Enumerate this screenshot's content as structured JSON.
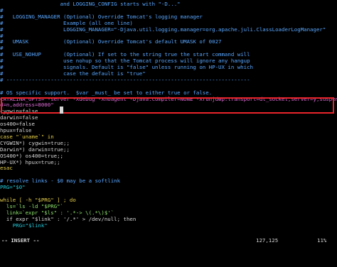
{
  "editor": {
    "lines": [
      {
        "text": "                   and LOGGING_CONFIG starts with \"-D...\"",
        "cls": "c-comment"
      },
      {
        "text": "#",
        "cls": "c-comment"
      },
      {
        "text": "#   LOGGING_MANAGER (Optional) Override Tomcat's logging manager",
        "cls": "c-comment"
      },
      {
        "text": "#                   Example (all one line)",
        "cls": "c-comment"
      },
      {
        "text": "#                   LOGGING_MANAGER=\"-Djava.util.logging.manager=org.apache.juli.ClassLoaderLogManager\"",
        "cls": "c-comment"
      },
      {
        "text": "#",
        "cls": "c-comment"
      },
      {
        "text": "#   UMASK           (Optional) Override Tomcat's default UMASK of 0027",
        "cls": "c-comment"
      },
      {
        "text": "#",
        "cls": "c-comment"
      },
      {
        "text": "#   USE_NOHUP       (Optional) If set to the string true the start command will",
        "cls": "c-comment"
      },
      {
        "text": "#                   use nohup so that the Tomcat process will ignore any hangup",
        "cls": "c-comment"
      },
      {
        "text": "#                   signals. Default is \"false\" unless running on HP-UX in which",
        "cls": "c-comment"
      },
      {
        "text": "#                   case the default is \"true\"",
        "cls": "c-comment"
      },
      {
        "text": "# -----------------------------------------------------------------------------",
        "cls": "c-comment"
      },
      {
        "text": "",
        "cls": "c-plain"
      },
      {
        "text": "# OS specific support.  $var _must_ be set to either true or false.",
        "cls": "c-comment"
      },
      {
        "text": "CATALINA_OPTS=\"-server -Xdebug -Xnoagent -Djava.compiler=NONE -Xrunjdwp:transport=dt_socket,server=y,suspen",
        "cls": "c-str"
      },
      {
        "text": "d=n,address=8000\"",
        "cls": "c-str"
      },
      {
        "text": "cygwin=false",
        "cls": "c-plain"
      },
      {
        "text": "darwin=false",
        "cls": "c-plain"
      },
      {
        "text": "os400=false",
        "cls": "c-plain"
      },
      {
        "text": "hpux=false",
        "cls": "c-plain"
      },
      {
        "text": "case \"`uname`\" in",
        "cls": "c-kw"
      },
      {
        "text": "CYGWIN*) cygwin=true;;",
        "cls": "c-plain"
      },
      {
        "text": "Darwin*) darwin=true;;",
        "cls": "c-plain"
      },
      {
        "text": "OS400*) os400=true;;",
        "cls": "c-plain"
      },
      {
        "text": "HP-UX*) hpux=true;;",
        "cls": "c-plain"
      },
      {
        "text": "esac",
        "cls": "c-kw"
      },
      {
        "text": "",
        "cls": "c-plain"
      },
      {
        "text": "# resolve links - $0 may be a softlink",
        "cls": "c-comment"
      },
      {
        "text": "PRG=\"$0\"",
        "cls": "c-var"
      },
      {
        "text": "",
        "cls": "c-plain"
      },
      {
        "text": "while [ -h \"$PRG\" ] ; do",
        "cls": "c-kw"
      },
      {
        "text": "  ls=`ls -ld \"$PRG\"`",
        "cls": "c-green"
      },
      {
        "text": "  link=`expr \"$ls\" : '.*-> \\(.*\\)$'`",
        "cls": "c-green"
      },
      {
        "text": "  if expr \"$link\" : '/.*' > /dev/null; then",
        "cls": "c-plain"
      },
      {
        "text": "    PRG=\"$link\"",
        "cls": "c-var"
      },
      {
        "text": "",
        "cls": "c-plain"
      }
    ]
  },
  "status": {
    "mode": "-- INSERT --",
    "position": "127,125",
    "percent": "11%"
  }
}
